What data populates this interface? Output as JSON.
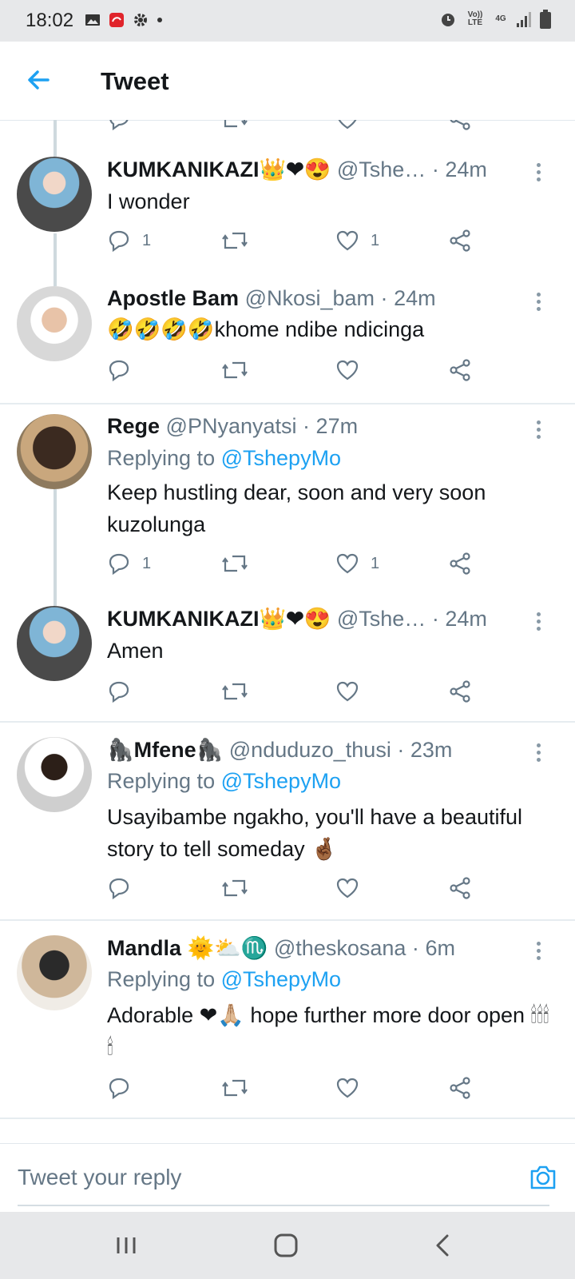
{
  "status_bar": {
    "time": "18:02",
    "network_volte": "Vo)) LTE",
    "network_type": "4G"
  },
  "header": {
    "title": "Tweet"
  },
  "tweets": [
    {
      "name": "KUMKANIKAZI👑❤😍",
      "handle": "@Tshe…",
      "time": "24m",
      "text": "I wonder",
      "replies": "1",
      "retweets": "",
      "likes": "1"
    },
    {
      "name": "Apostle Bam",
      "handle": "@Nkosi_bam",
      "time": "24m",
      "text": "🤣🤣🤣🤣khome ndibe ndicinga",
      "replies": "",
      "retweets": "",
      "likes": ""
    },
    {
      "name": "Rege",
      "handle": "@PNyanyatsi",
      "time": "27m",
      "replying_prefix": "Replying to",
      "replying_to": "@TshepyMo",
      "text": "Keep hustling dear, soon and very soon kuzolunga",
      "replies": "1",
      "retweets": "",
      "likes": "1"
    },
    {
      "name": "KUMKANIKAZI👑❤😍",
      "handle": "@Tshe…",
      "time": "24m",
      "text": "Amen",
      "replies": "",
      "retweets": "",
      "likes": ""
    },
    {
      "name": "🦍Mfene🦍",
      "handle": "@nduduzo_thusi",
      "time": "23m",
      "replying_prefix": "Replying to",
      "replying_to": "@TshepyMo",
      "text": "Usayibambe ngakho, you'll have a beautiful story to tell someday 🤞🏾",
      "replies": "",
      "retweets": "",
      "likes": ""
    },
    {
      "name": "Mandla 🌞⛅♏",
      "handle": "@theskosana",
      "time": "6m",
      "replying_prefix": "Replying to",
      "replying_to": "@TshepyMo",
      "text": "Adorable ❤🙏🏼 hope further more door open 🕯🕯🕯🕯",
      "replies": "",
      "retweets": "",
      "likes": ""
    }
  ],
  "composer": {
    "placeholder": "Tweet your reply"
  },
  "colors": {
    "accent": "#1da1f2",
    "meta": "#657786",
    "text": "#14171a",
    "separator": "#e6ecf0"
  }
}
